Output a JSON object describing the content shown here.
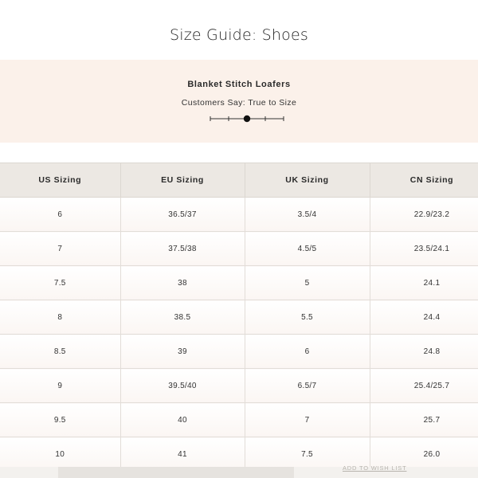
{
  "page": {
    "title": "Size Guide: Shoes"
  },
  "fit": {
    "product_name": "Blanket Stitch Loafers",
    "customers_say": "Customers Say: True to Size",
    "scale_steps": 5,
    "scale_selected_index": 2
  },
  "size_table": {
    "headers": [
      "US Sizing",
      "EU Sizing",
      "UK Sizing",
      "CN Sizing"
    ],
    "rows": [
      [
        "6",
        "36.5/37",
        "3.5/4",
        "22.9/23.2"
      ],
      [
        "7",
        "37.5/38",
        "4.5/5",
        "23.5/24.1"
      ],
      [
        "7.5",
        "38",
        "5",
        "24.1"
      ],
      [
        "8",
        "38.5",
        "5.5",
        "24.4"
      ],
      [
        "8.5",
        "39",
        "6",
        "24.8"
      ],
      [
        "9",
        "39.5/40",
        "6.5/7",
        "25.4/25.7"
      ],
      [
        "9.5",
        "40",
        "7",
        "25.7"
      ],
      [
        "10",
        "41",
        "7.5",
        "26.0"
      ]
    ]
  },
  "footer": {
    "wish_list_label": "ADD TO WISH LIST"
  },
  "colors": {
    "panel_bg": "#fbf1ea",
    "header_bg": "#ece8e3",
    "text": "#2b2b2b"
  }
}
